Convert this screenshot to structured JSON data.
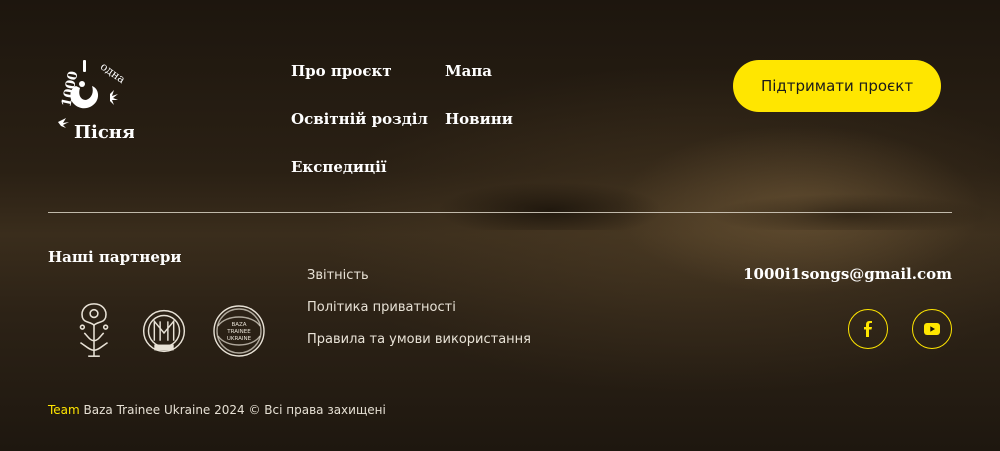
{
  "logo": {
    "text_top": "1000 і одна",
    "text_bottom": "Пісня",
    "icon": "folk-bird-logo-icon"
  },
  "nav": {
    "about": "Про проєкт",
    "map": "Мапа",
    "education": "Освітній розділ",
    "news": "Новини",
    "expeditions": "Експедиції"
  },
  "support_button": "Підтримати проєкт",
  "partners": {
    "title": "Наші партнери",
    "items": [
      {
        "icon": "ornament-emblem-icon"
      },
      {
        "icon": "academy-seal-icon"
      },
      {
        "icon": "baza-trainee-ukraine-logo-icon",
        "text": [
          "BAZA",
          "TRAINEE",
          "UKRAINE"
        ]
      }
    ]
  },
  "legal": {
    "reports": "Звітність",
    "privacy": "Політика приватності",
    "terms": "Правила та умови використання"
  },
  "contact": {
    "email": "1000i1songs@gmail.com"
  },
  "social": [
    {
      "icon": "facebook-icon"
    },
    {
      "icon": "youtube-icon"
    }
  ],
  "footer": {
    "team": "Team",
    "copyright": " Baza Trainee Ukraine 2024 © Всі права захищені"
  },
  "colors": {
    "accent": "#ffe600",
    "background": "#1a140d",
    "text": "#ffffff"
  }
}
